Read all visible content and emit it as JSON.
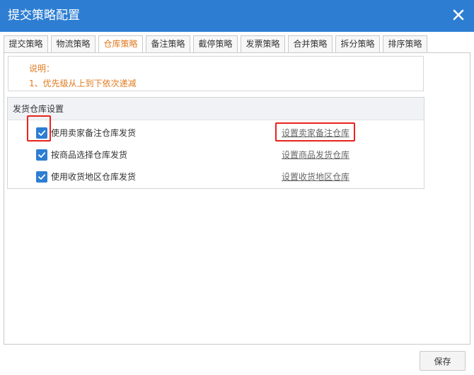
{
  "dialog": {
    "title": "提交策略配置",
    "close_icon": "close-icon"
  },
  "tabs": [
    {
      "label": "提交策略",
      "active": false
    },
    {
      "label": "物流策略",
      "active": false
    },
    {
      "label": "仓库策略",
      "active": true
    },
    {
      "label": "备注策略",
      "active": false
    },
    {
      "label": "截停策略",
      "active": false
    },
    {
      "label": "发票策略",
      "active": false
    },
    {
      "label": "合并策略",
      "active": false
    },
    {
      "label": "拆分策略",
      "active": false
    },
    {
      "label": "排序策略",
      "active": false
    }
  ],
  "note": {
    "line1": "说明：",
    "line2": "1、优先级从上到下依次递减"
  },
  "warehouse_settings": {
    "heading": "发货仓库设置",
    "rows": [
      {
        "label": "使用卖家备注仓库发货",
        "checked": true,
        "link": "设置卖家备注仓库"
      },
      {
        "label": "按商品选择仓库发货",
        "checked": true,
        "link": "设置商品发货仓库"
      },
      {
        "label": "使用收货地区仓库发货",
        "checked": true,
        "link": "设置收货地区仓库"
      }
    ]
  },
  "footer": {
    "save_label": "保存"
  },
  "colors": {
    "titlebar": "#2d7ed3",
    "active_tab_text": "#e07a1f",
    "note_text": "#e07a1f",
    "checkbox": "#2d7ed3",
    "highlight": "#e8231b"
  }
}
